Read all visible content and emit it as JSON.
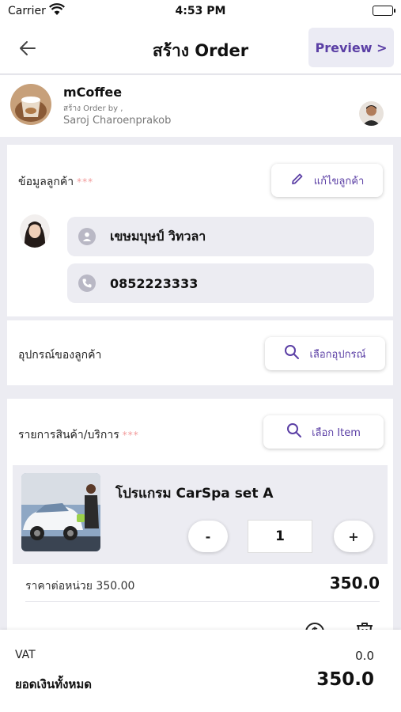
{
  "status_bar": {
    "carrier": "Carrier",
    "time": "4:53 PM"
  },
  "nav": {
    "title": "สร้าง Order",
    "preview_label": "Preview >"
  },
  "shop": {
    "name": "mCoffee",
    "created_by_label": "สร้าง Order by ,",
    "creator_name": "Saroj Charoenprakob"
  },
  "customer": {
    "section_label": "ข้อมูลลูกค้า",
    "required_mark": "***",
    "edit_button_label": "แก้ไขลูกค้า",
    "name": "เขษมบุษป์ วิทวลา",
    "phone": "0852223333"
  },
  "equipment": {
    "section_label": "อุปกรณ์ของลูกค้า",
    "select_button_label": "เลือกอุปกรณ์"
  },
  "items": {
    "section_label": "รายการสินค้า/บริการ",
    "required_mark": "***",
    "select_button_label": "เลือก Item",
    "list": [
      {
        "name": "โปรแกรม CarSpa set A",
        "minus_label": "-",
        "quantity": "1",
        "plus_label": "+",
        "unit_price_text": "ราคาต่อหน่วย 350.00",
        "line_total": "350.0"
      }
    ]
  },
  "summary": {
    "vat_label": "VAT",
    "vat_value": "0.0",
    "total_label": "ยอดเงินทั้งหมด",
    "total_value": "350.0"
  },
  "colors": {
    "accent": "#5b3fa5",
    "required": "#f29a9a",
    "page_bg": "#ececf2"
  }
}
